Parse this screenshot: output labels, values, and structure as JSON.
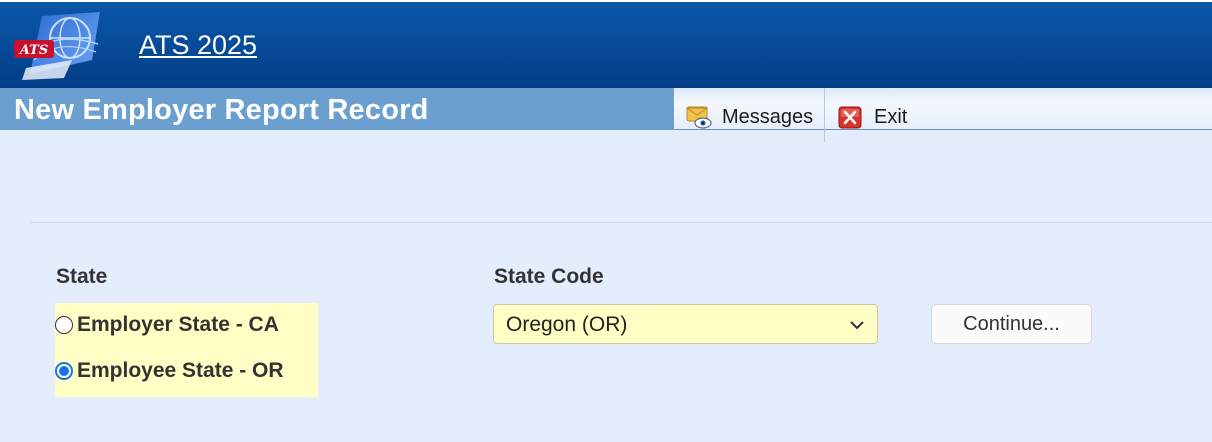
{
  "app": {
    "title": "ATS 2025"
  },
  "page": {
    "title": "New Employer Report Record"
  },
  "toolbar": {
    "messages_label": "Messages",
    "exit_label": "Exit"
  },
  "form": {
    "state_label": "State",
    "state_options": [
      {
        "label": "Employer State - CA",
        "checked": false
      },
      {
        "label": "Employee State - OR",
        "checked": true
      }
    ],
    "state_code_label": "State Code",
    "state_code_value": "Oregon (OR)",
    "continue_label": "Continue..."
  },
  "colors": {
    "header_blue": "#064a98",
    "title_bar_blue": "#6b9fcf",
    "content_bg": "#e3edfb",
    "highlight_yellow": "#ffffc5",
    "radio_accent": "#1a73e8"
  },
  "icons": {
    "logo": "ats-logo",
    "messages": "messages-icon",
    "exit": "exit-icon",
    "dropdown": "chevron-down-icon"
  }
}
